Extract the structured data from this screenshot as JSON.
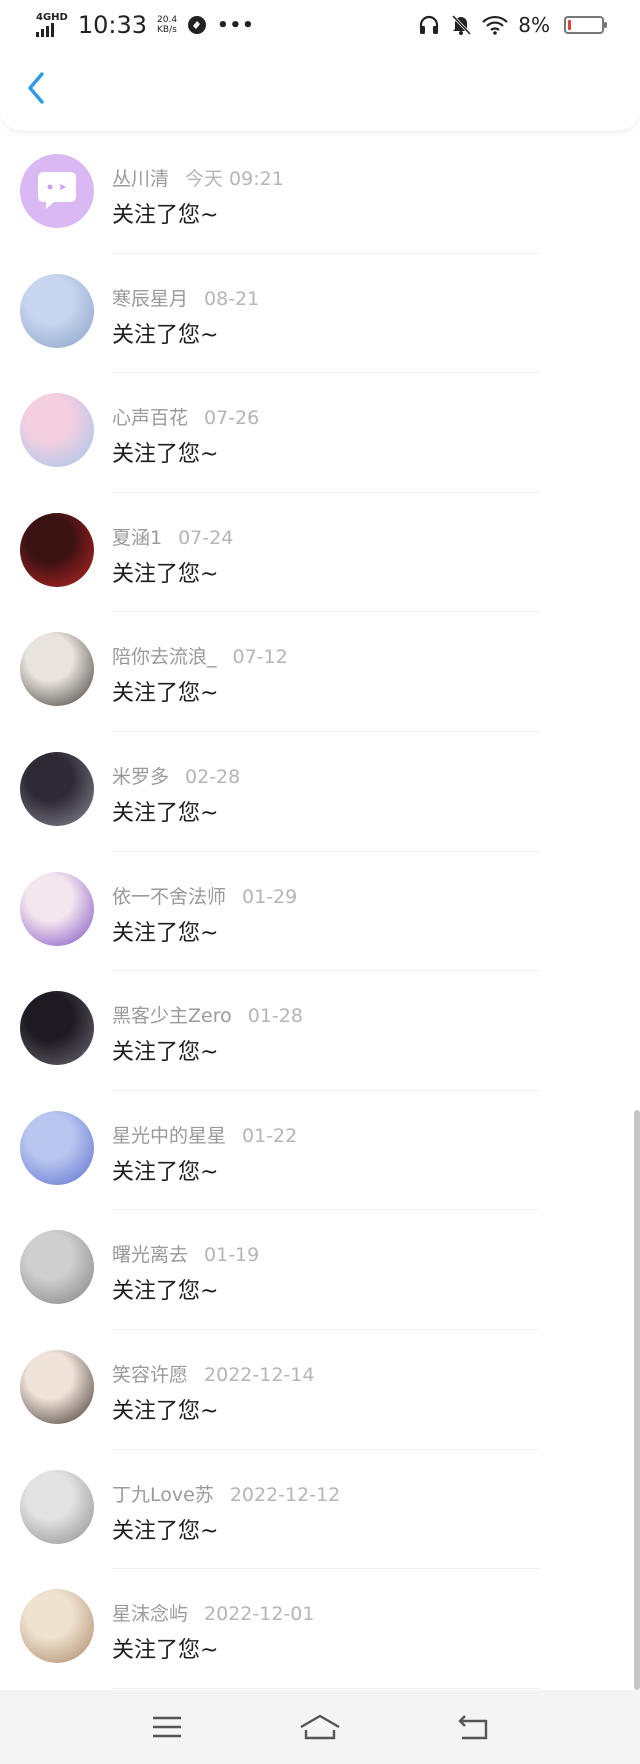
{
  "status_bar": {
    "network": "4GHD",
    "time": "10:33",
    "speed_value": "20.4",
    "speed_unit": "KB/s",
    "more": "•••",
    "battery_percent": "8%",
    "battery_level": 0.08
  },
  "header": {
    "back_icon": "chevron-left-icon"
  },
  "notifications": [
    {
      "name": "丛川清",
      "date": "今天 09:21",
      "message": "关注了您~"
    },
    {
      "name": "寒辰星月",
      "date": "08-21",
      "message": "关注了您~"
    },
    {
      "name": "心声百花",
      "date": "07-26",
      "message": "关注了您~"
    },
    {
      "name": "夏涵1",
      "date": "07-24",
      "message": "关注了您~"
    },
    {
      "name": "陪你去流浪_",
      "date": "07-12",
      "message": "关注了您~"
    },
    {
      "name": "米罗多",
      "date": "02-28",
      "message": "关注了您~"
    },
    {
      "name": "依一不舍法师",
      "date": "01-29",
      "message": "关注了您~"
    },
    {
      "name": "黑客少主Zero",
      "date": "01-28",
      "message": "关注了您~"
    },
    {
      "name": "星光中的星星",
      "date": "01-22",
      "message": "关注了您~"
    },
    {
      "name": "曙光离去",
      "date": "01-19",
      "message": "关注了您~"
    },
    {
      "name": "笑容许愿",
      "date": "2022-12-14",
      "message": "关注了您~"
    },
    {
      "name": "丁九Love苏",
      "date": "2022-12-12",
      "message": "关注了您~"
    },
    {
      "name": "星沫念屿",
      "date": "2022-12-01",
      "message": "关注了您~"
    }
  ],
  "colors": {
    "accent": "#2a9ae8",
    "default_avatar": "#d9b8f3",
    "name_text": "#9a9a9a",
    "message_text": "#1e1e1e"
  },
  "nav": {
    "menu_icon": "menu-icon",
    "home_icon": "home-icon",
    "back_icon": "back-arrow-icon"
  }
}
